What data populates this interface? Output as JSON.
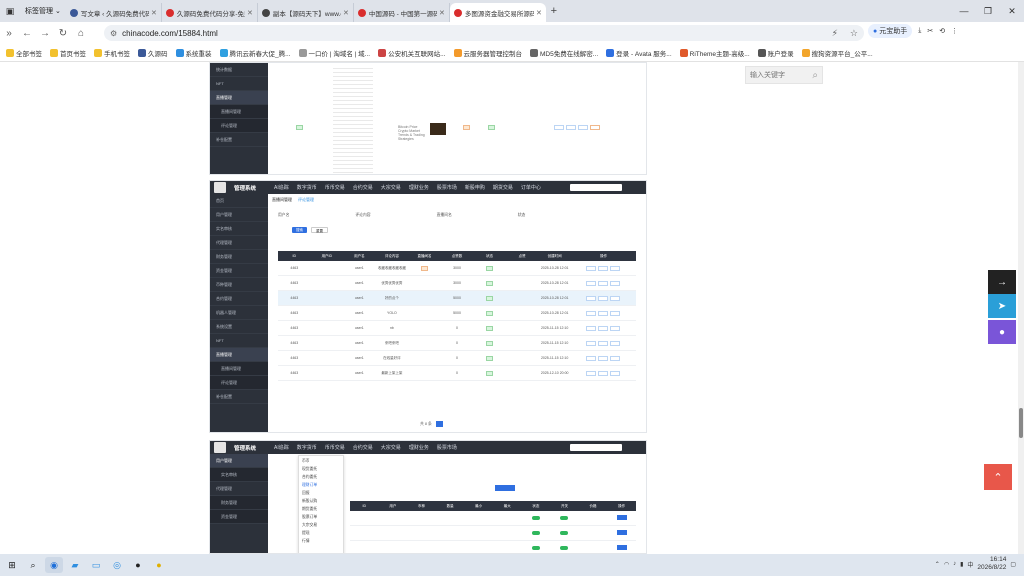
{
  "browser": {
    "tab_group_label": "标签管理",
    "tabs": [
      {
        "title": "写文章 ‹ 久源码免费代码分享 — W",
        "color": "#3b5998"
      },
      {
        "title": "久源码免费代码分享-免费游戏源码",
        "color": "#d92d2d"
      },
      {
        "title": "副本【源码天下】www.chinacode",
        "color": "#444444"
      },
      {
        "title": "中国源码 - 中国第一源码下载与交",
        "color": "#d92d2d"
      },
      {
        "title": "多图源资金融交易所源码/ave",
        "color": "#d92d2d",
        "active": true
      }
    ],
    "url": "chinacode.com/15884.html",
    "profile_label": "元宝助手",
    "bookmarks": [
      "全部书签",
      "首页书签",
      "手机书签",
      "久源码",
      "系统重装",
      "腾讯云新春大促_腾...",
      "一口价 | 淘域名 | 域...",
      "公安机关互联网站...",
      "云服务器管理控制台",
      "MD5免费在线解密...",
      "登录 - Avata 服务...",
      "RiTheme主题-高级...",
      "账户登录",
      "搜狗资源平台_公平..."
    ]
  },
  "page": {
    "search_placeholder": "输入关键字",
    "shot1": {
      "side_items": [
        "统计数据",
        "NFT",
        "直播管理",
        "直播间管理",
        "评论管理",
        "补仓配置"
      ],
      "row_text": "Bitcoin Price Crypto Market Trends & Trading Strategies"
    },
    "shot2": {
      "system_title": "管理系统",
      "nav": [
        "AI追踪",
        "数字货币",
        "币币交易",
        "合约交易",
        "大宗交易",
        "理财业务",
        "股票市场",
        "新股申购",
        "期货交易",
        "订单中心"
      ],
      "tabs": [
        "直播间管理",
        "评论管理"
      ],
      "side_items": [
        "首页",
        "用户管理",
        "实名审核",
        "代理管理",
        "财务管理",
        "资金管理",
        "币种管理",
        "合约管理",
        "机器人管理",
        "系统设置",
        "NFT",
        "直播管理",
        "直播间管理",
        "评论管理",
        "补仓配置"
      ],
      "filter_labels": [
        "用户名",
        "评论内容",
        "直播间名",
        "状态"
      ],
      "search_btn": "搜索",
      "reset_btn": "重置",
      "columns": [
        "ID",
        "用户ID",
        "用户名",
        "评论内容",
        "直播间名",
        "点赞数",
        "状态",
        "点赞",
        "创建时间",
        "操作"
      ],
      "rows": [
        {
          "id": "4463",
          "user": "user1",
          "content": "收藏收藏收藏收藏",
          "likes": "3000",
          "time": "2025-10-28 12:01"
        },
        {
          "id": "4463",
          "user": "user1",
          "content": "优秀优秀优秀",
          "likes": "3000",
          "time": "2025-10-28 12:01"
        },
        {
          "id": "4463",
          "user": "user1",
          "content": "好的点个",
          "likes": "5000",
          "time": "2025-10-28 12:01"
        },
        {
          "id": "4463",
          "user": "user1",
          "content": "YOLO",
          "likes": "5000",
          "time": "2025-10-28 12:01"
        },
        {
          "id": "4463",
          "user": "user1",
          "content": "nb",
          "likes": "0",
          "time": "2025-11-15 12:10"
        },
        {
          "id": "4463",
          "user": "user1",
          "content": "来吧来吧",
          "likes": "0",
          "time": "2025-11-15 12:10"
        },
        {
          "id": "4463",
          "user": "user1",
          "content": "在线量好评",
          "likes": "0",
          "time": "2025-11-15 12:10"
        },
        {
          "id": "4463",
          "user": "user1",
          "content": "最新上架上架",
          "likes": "0",
          "time": "2025-12-10 20:00"
        }
      ],
      "pagination": "共 8 条"
    },
    "shot3": {
      "system_title": "管理系统",
      "menu_items": [
        "币币",
        "现货委托",
        "合约委托",
        "理财订单",
        "回报",
        "新股认购",
        "期货委托",
        "股票订单",
        "大宗交易",
        "提现",
        "行情"
      ],
      "columns": [
        "ID",
        "用户",
        "币种",
        "数量",
        "最小",
        "最大",
        "状态",
        "开关",
        "价格",
        "操作"
      ]
    }
  },
  "taskbar": {
    "time": "16:14",
    "date": "2026/8/22",
    "lang": "中"
  }
}
